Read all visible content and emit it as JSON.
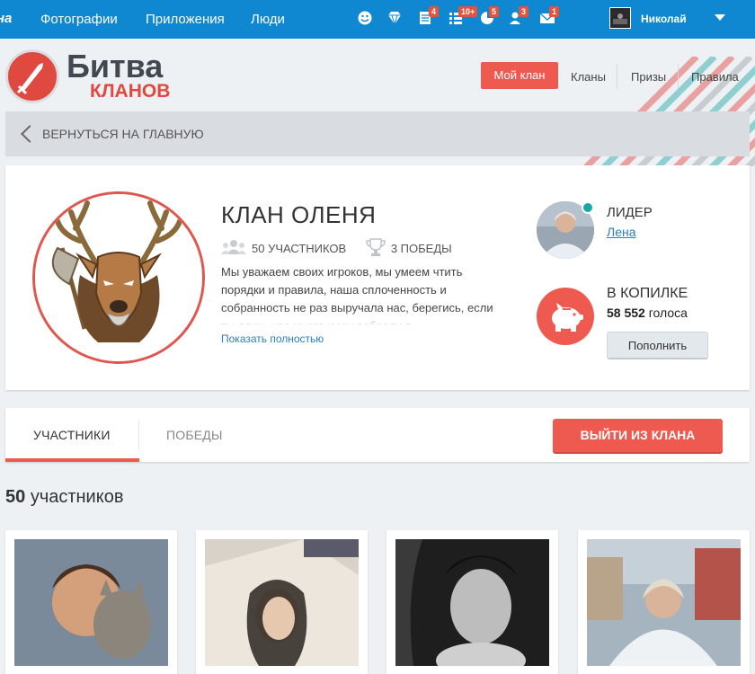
{
  "topbar": {
    "brand_fragment": "на",
    "nav": [
      "Фотографии",
      "Приложения",
      "Люди"
    ],
    "badges": {
      "feed": "4",
      "events": "10+",
      "guests": "5",
      "friends": "3",
      "messages": "1"
    },
    "user_name": "Николай"
  },
  "header": {
    "logo_title": "Битва",
    "logo_subtitle": "КЛАНОВ",
    "nav": {
      "my_clan": "Мой клан",
      "clans": "Кланы",
      "prizes": "Призы",
      "rules": "Правила"
    },
    "back_label": "ВЕРНУТЬСЯ НА ГЛАВНУЮ"
  },
  "clan": {
    "title": "КЛАН ОЛЕНЯ",
    "members_label": "50 УЧАСТНИКОВ",
    "wins_label": "3 ПОБЕДЫ",
    "description": "Мы уважаем своих игроков, мы умеем чтить порядки и правила, наша сплоченность и собранность не раз выручала нас, берегись, если ты один, нас много и мы собрали в",
    "show_more": "Показать полностью",
    "leader_label": "ЛИДЕР",
    "leader_name": "Лена",
    "bank_label": "В КОПИЛКЕ",
    "bank_amount": "58 552",
    "bank_unit": "голоса",
    "refill_label": "Пополнить"
  },
  "tabs": {
    "members": "УЧАСТНИКИ",
    "wins": "ПОБЕДЫ",
    "leave": "ВЫЙТИ ИЗ КЛАНА"
  },
  "members_section": {
    "count": "50",
    "label": "участников"
  },
  "colors": {
    "topbar": "#0f87d1",
    "accent": "#ee5a4f",
    "link": "#2a7fc5",
    "online": "#17a7a7"
  }
}
